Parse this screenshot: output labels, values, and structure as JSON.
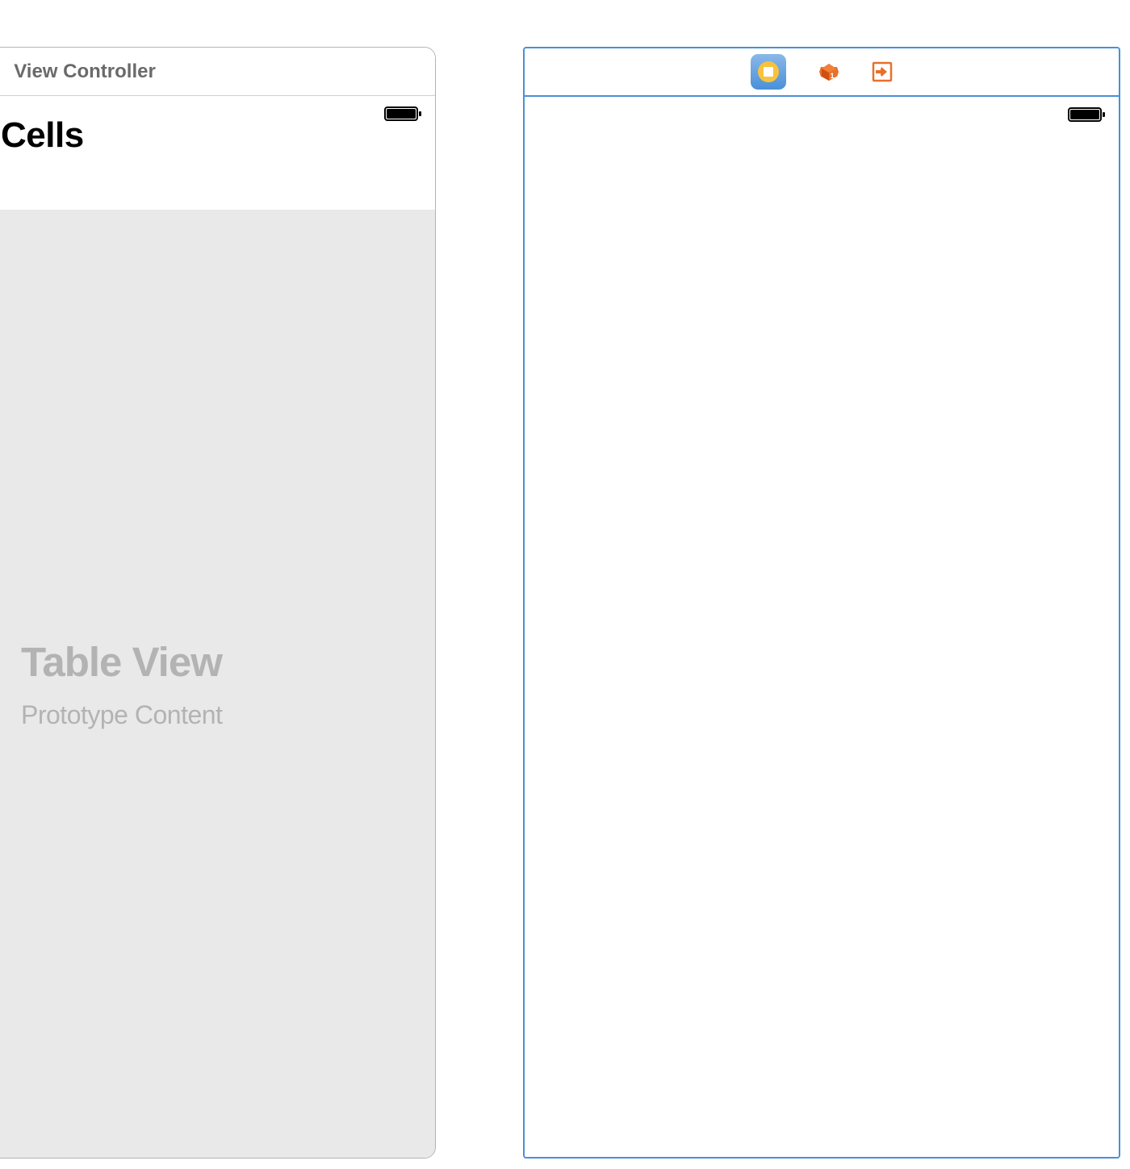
{
  "leftScene": {
    "title": "View Controller",
    "navTitle": "Cells",
    "tableView": {
      "placeholder": "Table View",
      "subtitle": "Prototype Content"
    }
  },
  "rightScene": {
    "selected": true,
    "icons": {
      "viewController": "view-controller-icon",
      "firstResponder": "first-responder-icon",
      "exit": "exit-icon"
    }
  }
}
